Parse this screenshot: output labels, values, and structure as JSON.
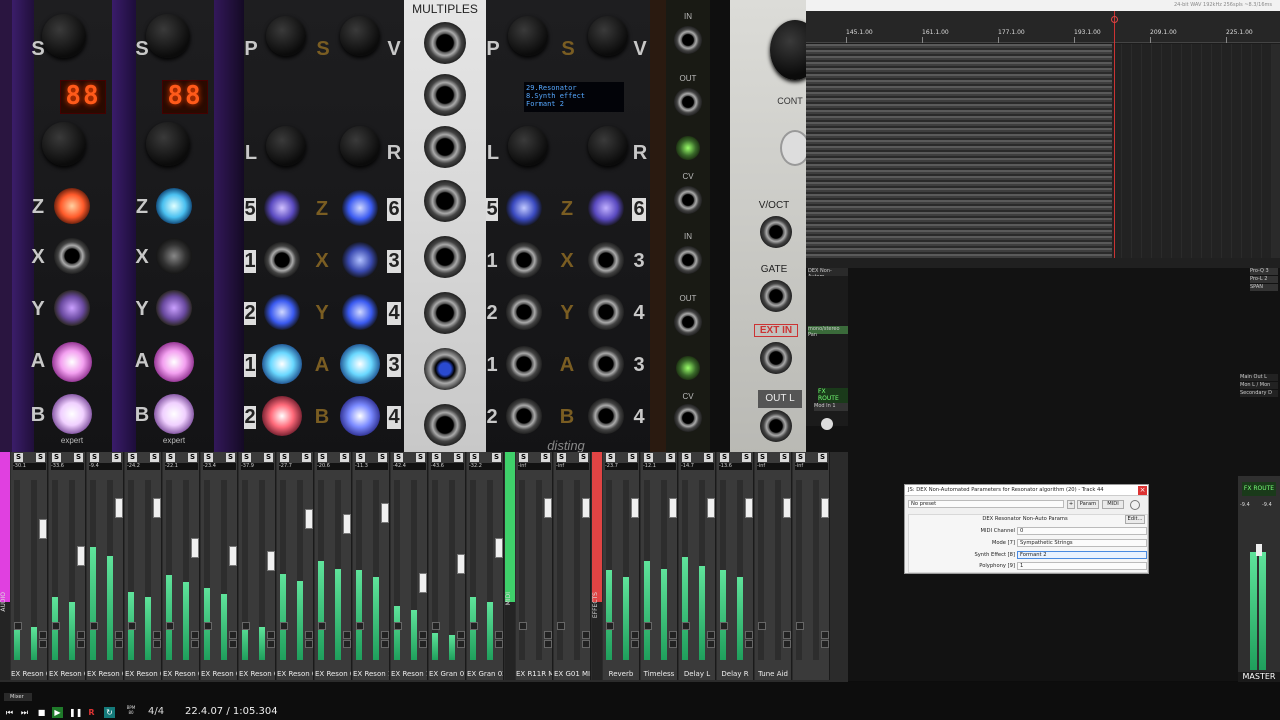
{
  "rack": {
    "modules": [
      {
        "name": "expert-sleepers-1",
        "seg": "88",
        "labels": [
          "S",
          "Z",
          "X",
          "Y",
          "A",
          "B"
        ],
        "footer": "expert"
      },
      {
        "name": "expert-sleepers-2",
        "seg": "88",
        "labels": [
          "S",
          "Z",
          "X",
          "Y",
          "A",
          "B"
        ],
        "footer": "expert"
      }
    ],
    "dual_top_labels": [
      "P",
      "S",
      "V",
      "L",
      "R"
    ],
    "dual_rows": [
      [
        "5",
        "Z",
        "6"
      ],
      [
        "1",
        "X",
        "3"
      ],
      [
        "2",
        "Y",
        "4"
      ],
      [
        "1",
        "A",
        "3"
      ],
      [
        "2",
        "B",
        "4"
      ]
    ],
    "multiples_title": "MULTIPLES",
    "oled_lines": [
      "29.Resonator",
      "  8.Synth effect",
      "          Formant 2"
    ],
    "io_labels": [
      "IN",
      "OUT",
      "CV",
      "IN",
      "OUT",
      "CV"
    ],
    "right_labels": {
      "voct": "V/OCT",
      "gate": "GATE",
      "extin": "EXT IN",
      "outl": "OUT L",
      "cont": "CONT"
    },
    "brand": "disting"
  },
  "arrange": {
    "title": "24-bit WAV 192kHz 256spls ~8.3/16ms",
    "ruler_marks": [
      "145.1.00",
      "161.1.00",
      "177.1.00",
      "193.1.00",
      "209.1.00",
      "225.1.00"
    ]
  },
  "tcp": {
    "track1": "DEX Non-Autom",
    "track2": "mono/stereo Pan",
    "fx_route": "FX ROUTE",
    "mod": "Mod In 1",
    "right_items": [
      "Pro-Q 3",
      "Pro-L 2",
      "SPAN"
    ],
    "master_items": [
      "Main Out L",
      "Mon L / Mon",
      "Secondary D"
    ]
  },
  "mixer": {
    "group_labels": [
      "AUDIO",
      "MIDI",
      "EFFECTS"
    ],
    "strips": [
      {
        "name": "EX Reson 01",
        "peak": "-30.1",
        "level": 0.2,
        "fader": 0.72
      },
      {
        "name": "EX Reson 02",
        "peak": "-33.6",
        "level": 0.35,
        "fader": 0.55
      },
      {
        "name": "EX Reson 03",
        "peak": "-9.4",
        "level": 0.63,
        "fader": 0.85
      },
      {
        "name": "EX Reson 04",
        "peak": "-24.2",
        "level": 0.38,
        "fader": 0.85
      },
      {
        "name": "EX Reson 05",
        "peak": "-22.1",
        "level": 0.47,
        "fader": 0.6
      },
      {
        "name": "EX Reson 06",
        "peak": "-23.4",
        "level": 0.4,
        "fader": 0.55
      },
      {
        "name": "EX Reson 07",
        "peak": "-37.9",
        "level": 0.2,
        "fader": 0.52
      },
      {
        "name": "EX Reson 08",
        "peak": "-27.7",
        "level": 0.48,
        "fader": 0.78
      },
      {
        "name": "EX Reson 09",
        "peak": "-20.6",
        "level": 0.55,
        "fader": 0.75
      },
      {
        "name": "EX Reson 10",
        "peak": "-11.3",
        "level": 0.5,
        "fader": 0.82
      },
      {
        "name": "EX Reson 11",
        "peak": "-42.4",
        "level": 0.3,
        "fader": 0.38
      },
      {
        "name": "EX Gran 01",
        "peak": "-43.6",
        "level": 0.15,
        "fader": 0.5
      },
      {
        "name": "EX Gran 02",
        "peak": "-32.2",
        "level": 0.35,
        "fader": 0.6
      },
      {
        "name": "EX R11R MIDI",
        "peak": "-inf",
        "level": 0.0,
        "fader": 0.85
      },
      {
        "name": "EX G01 MIDI",
        "peak": "-inf",
        "level": 0.0,
        "fader": 0.85
      },
      {
        "name": "Reverb",
        "peak": "-23.7",
        "level": 0.5,
        "fader": 0.85
      },
      {
        "name": "Timeless",
        "peak": "-12.1",
        "level": 0.55,
        "fader": 0.85
      },
      {
        "name": "Delay L",
        "peak": "-14.7",
        "level": 0.57,
        "fader": 0.85
      },
      {
        "name": "Delay R",
        "peak": "-13.6",
        "level": 0.5,
        "fader": 0.85
      },
      {
        "name": "Tune Aid",
        "peak": "-inf",
        "level": 0.0,
        "fader": 0.85
      },
      {
        "name": "",
        "peak": "-inf",
        "level": 0.0,
        "fader": 0.85
      }
    ],
    "master_label": "MASTER",
    "master_peaks": [
      "-9.4",
      "-9.4"
    ]
  },
  "plugin": {
    "title": "JS: DEX Non-Automated Parameters for Resonator algorithm (20) - Track 44",
    "preset": "No preset",
    "buttons": [
      "+",
      "Param",
      "MIDI"
    ],
    "header": "DEX Resonator Non-Auto Params",
    "edit": "Edit...",
    "params": [
      {
        "label": "MIDI Channel",
        "value": "0"
      },
      {
        "label": "Mode [7]",
        "value": "Sympathetic Strings"
      },
      {
        "label": "Synth Effect [8]",
        "value": "Formant 2"
      },
      {
        "label": "Polyphony [9]",
        "value": "1"
      }
    ]
  },
  "transport": {
    "bpm": "BPM 80",
    "time_sig": "4/4",
    "position": "22.4.07 / 1:05.304",
    "mixer_tab": "Mixer"
  }
}
